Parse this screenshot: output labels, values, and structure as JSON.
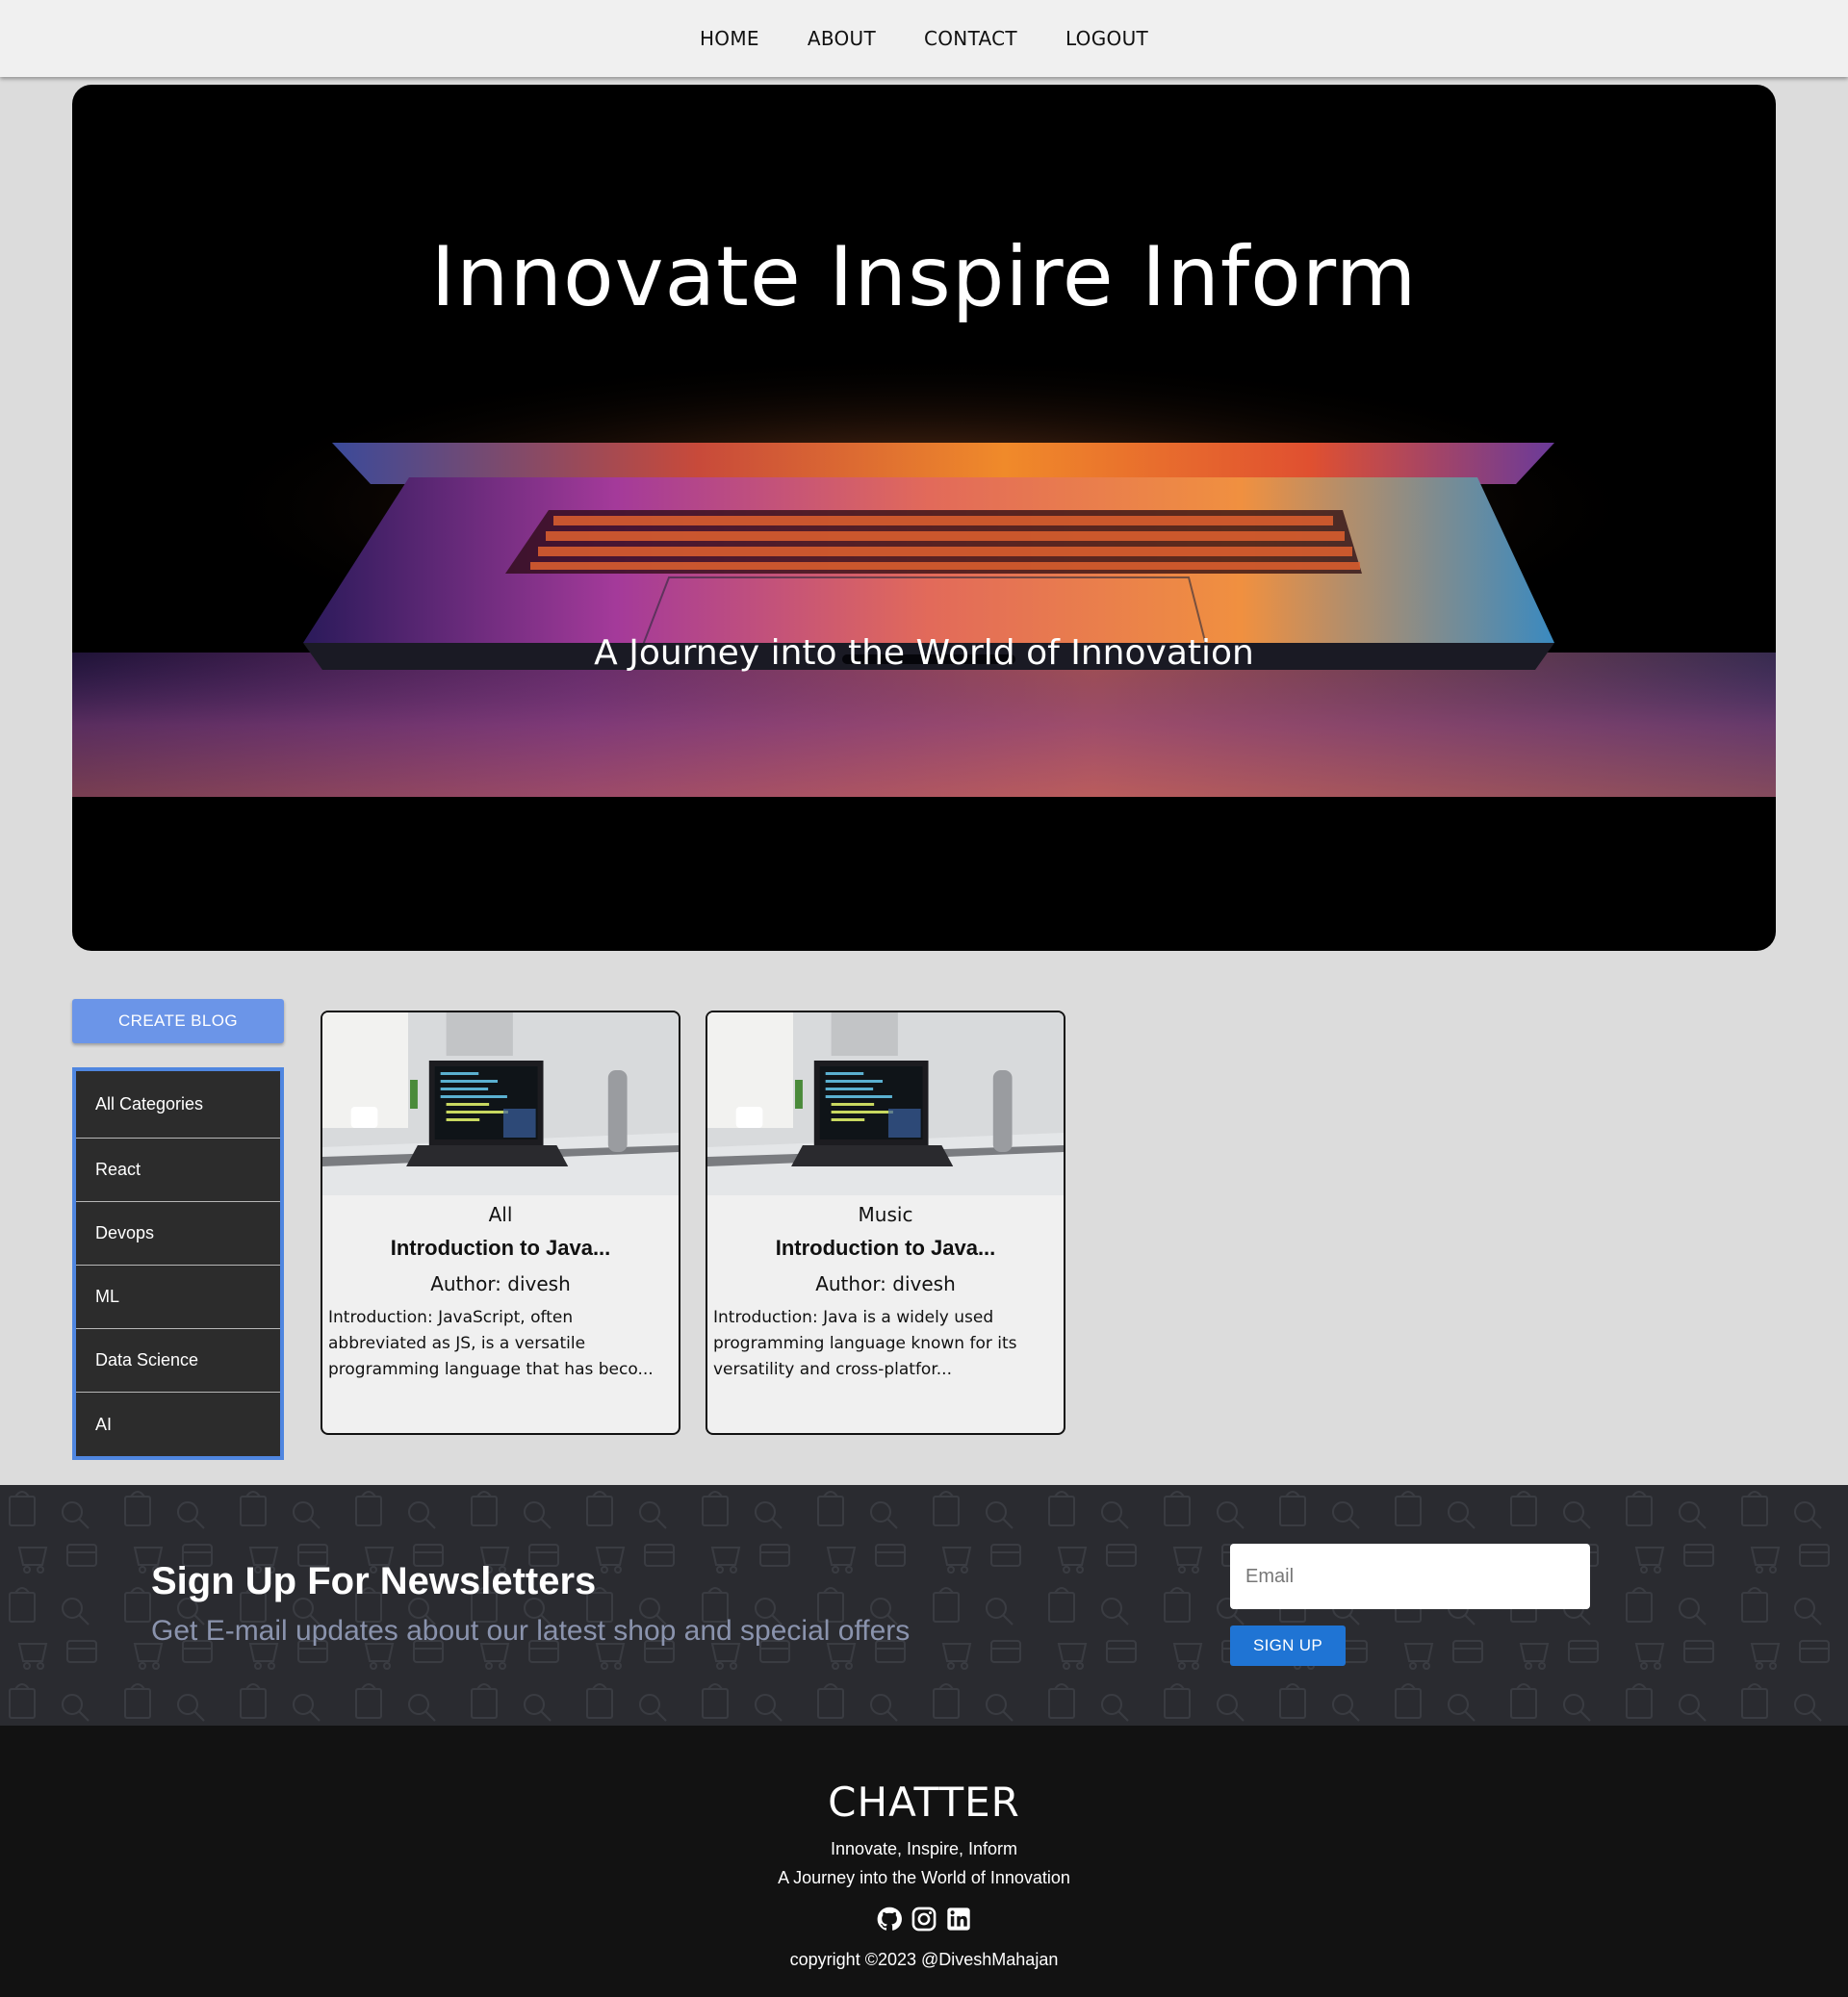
{
  "nav": {
    "items": [
      "HOME",
      "ABOUT",
      "CONTACT",
      "LOGOUT"
    ]
  },
  "hero": {
    "title": "Innovate Inspire Inform",
    "subtitle": "A Journey into the World of Innovation"
  },
  "sidebar": {
    "create_label": "CREATE BLOG",
    "categories": [
      "All Categories",
      "React",
      "Devops",
      "ML",
      "Data Science",
      "AI"
    ]
  },
  "posts": [
    {
      "category": "All",
      "title": "Introduction to Java...",
      "author": "Author: divesh",
      "excerpt": "Introduction: JavaScript, often abbreviated as JS, is a versatile programming language that has beco..."
    },
    {
      "category": "Music",
      "title": "Introduction to Java...",
      "author": "Author: divesh",
      "excerpt": "Introduction: Java is a widely used programming language known for its versatility and cross-platfor..."
    }
  ],
  "newsletter": {
    "title": "Sign Up For Newsletters",
    "subtitle": "Get E-mail updates about our latest shop and special offers",
    "email_placeholder": "Email",
    "signup_label": "SIGN UP"
  },
  "footer": {
    "brand": "CHATTER",
    "tagline": "Innovate, Inspire, Inform",
    "description": "A Journey into the World of Innovation",
    "icons": [
      "github-icon",
      "instagram-icon",
      "linkedin-icon"
    ],
    "copyright": "copyright ©2023 @DiveshMahajan"
  },
  "colors": {
    "primary_button": "#6b95e8",
    "signup_button": "#1f74d4",
    "category_border": "#4f86e0",
    "footer_bg": "#121212"
  }
}
